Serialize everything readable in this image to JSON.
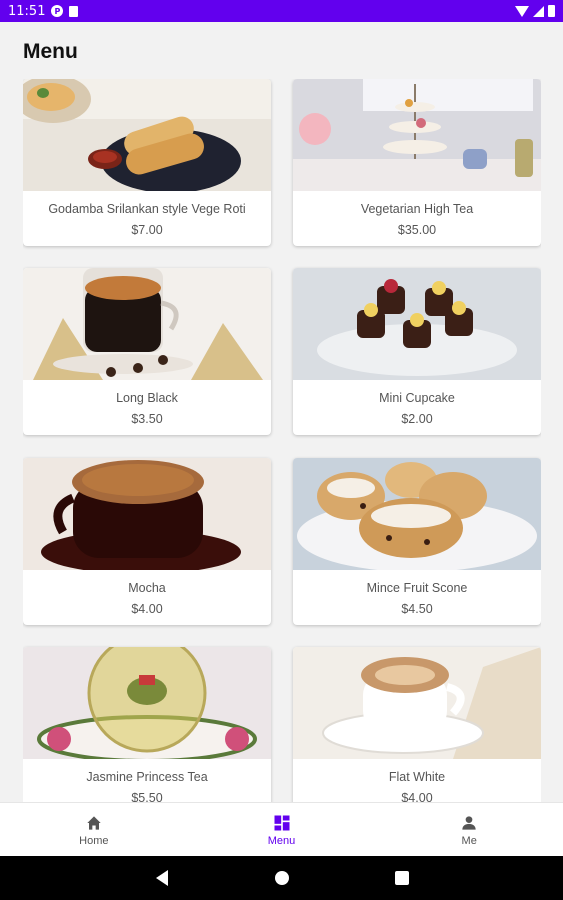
{
  "status_bar": {
    "time": "11:51",
    "badge": "P",
    "colors": {
      "bar": "#6200ee"
    }
  },
  "page": {
    "title": "Menu"
  },
  "menu_items": [
    {
      "name": "Godamba Srilankan style Vege Roti",
      "price": "$7.00",
      "image": "roti-photo"
    },
    {
      "name": "Vegetarian High Tea",
      "price": "$35.00",
      "image": "high-tea-photo"
    },
    {
      "name": "Long Black",
      "price": "$3.50",
      "image": "coffee-photo"
    },
    {
      "name": "Mini Cupcake",
      "price": "$2.00",
      "image": "cupcake-photo"
    },
    {
      "name": "Mocha",
      "price": "$4.00",
      "image": "mocha-photo"
    },
    {
      "name": "Mince Fruit Scone",
      "price": "$4.50",
      "image": "scone-photo"
    },
    {
      "name": "Jasmine Princess Tea",
      "price": "$5.50",
      "image": "tea-photo"
    },
    {
      "name": "Flat White",
      "price": "$4.00",
      "image": "flat-white-photo"
    }
  ],
  "bottom_nav": {
    "items": [
      {
        "label": "Home",
        "icon": "home-icon"
      },
      {
        "label": "Menu",
        "icon": "grid-icon",
        "active": true
      },
      {
        "label": "Me",
        "icon": "person-icon"
      }
    ],
    "accent": "#6200ee"
  },
  "system_nav": {
    "buttons": [
      "back-icon",
      "home-circle-icon",
      "recents-icon"
    ]
  }
}
